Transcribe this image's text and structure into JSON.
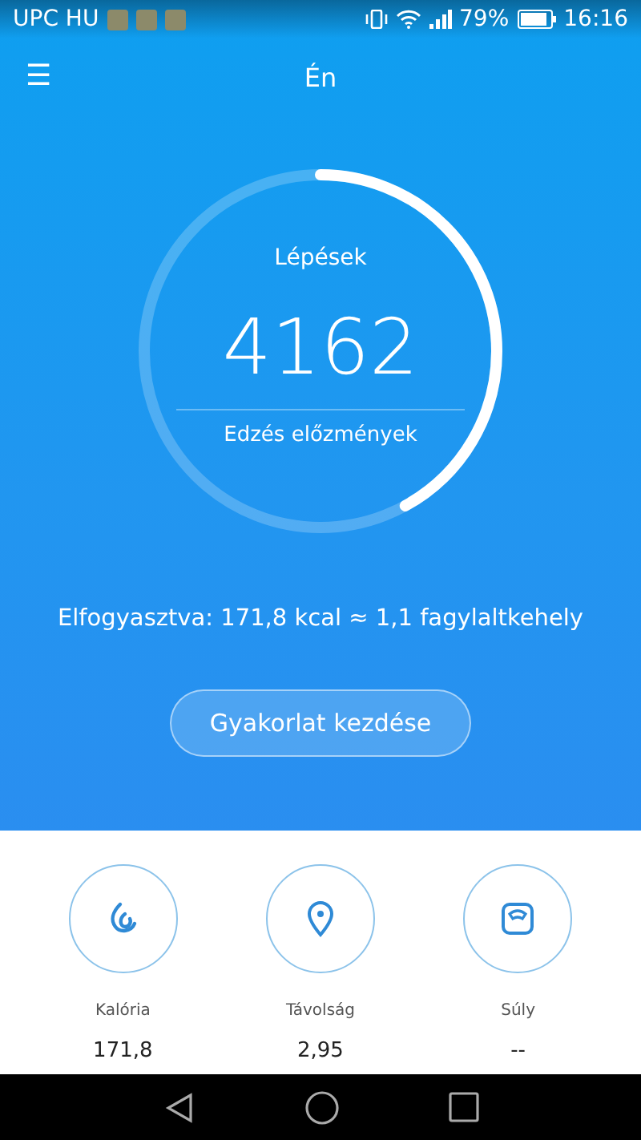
{
  "status_bar": {
    "carrier": "UPC HU",
    "battery_text": "79%",
    "time": "16:16"
  },
  "header": {
    "menu_glyph": "☰",
    "title": "Én"
  },
  "ring": {
    "label": "Lépések",
    "value": "4162",
    "link": "Edzés előzmények"
  },
  "consumed": "Elfogyasztva: 171,8 kcal ≈ 1,1 fagylaltkehely",
  "start_button": "Gyakorlat kezdése",
  "stats": [
    {
      "kind": "calorie",
      "label": "Kalória",
      "value": "171,8"
    },
    {
      "kind": "distance",
      "label": "Távolság",
      "value": "2,95"
    },
    {
      "kind": "weight",
      "label": "Súly",
      "value": "--"
    }
  ]
}
